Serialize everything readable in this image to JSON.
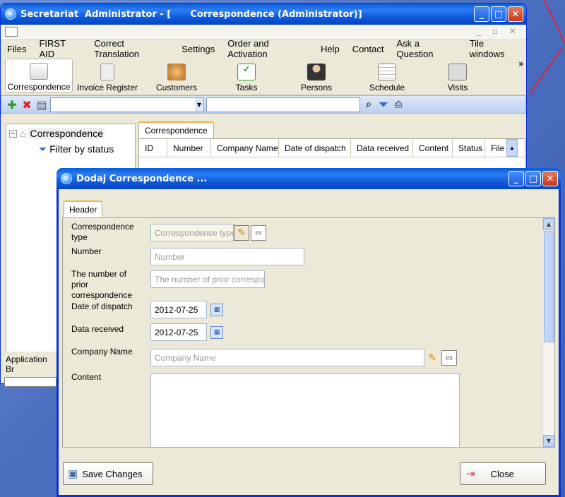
{
  "main_window": {
    "title": "Secretariat  Administrator - [      Correspondence (Administrator)]",
    "menu": [
      "Files",
      "FIRST AID",
      "Correct Translation",
      "Settings",
      "Order and Activation",
      "Help",
      "Contact",
      "Ask a Question",
      "Tile windows"
    ],
    "toolbar": [
      {
        "label": "Correspondence",
        "icon": "correspondence-icon",
        "selected": true
      },
      {
        "label": "Invoice Register",
        "icon": "invoice-icon"
      },
      {
        "label": "Customers",
        "icon": "customers-icon"
      },
      {
        "label": "Tasks",
        "icon": "tasks-icon"
      },
      {
        "label": "Persons",
        "icon": "persons-icon"
      },
      {
        "label": "Schedule",
        "icon": "schedule-icon"
      },
      {
        "label": "Visits",
        "icon": "visits-icon"
      }
    ],
    "tree": {
      "root": "Correspondence",
      "child": "Filter by status"
    },
    "grid_tab": "Correspondence",
    "columns": [
      "ID",
      "Number",
      "Company Name",
      "Date of dispatch",
      "Data received",
      "Content",
      "Status",
      "File"
    ],
    "status_label": "Application Br"
  },
  "dialog": {
    "title": "Dodaj Correspondence ...",
    "tab": "Header",
    "fields": {
      "type_label": "Correspondence type",
      "type_placeholder": "Correspondence type",
      "number_label": "Number",
      "number_placeholder": "Number",
      "prior_label": "The number of prior correspondence",
      "prior_placeholder": "The number of prior correspo...",
      "dispatch_label": "Date of dispatch",
      "dispatch_value": "2012-07-25",
      "received_label": "Data received",
      "received_value": "2012-07-25",
      "company_label": "Company Name",
      "company_placeholder": "Company Name",
      "content_label": "Content"
    },
    "save_label": "Save Changes",
    "close_label": "Close"
  }
}
